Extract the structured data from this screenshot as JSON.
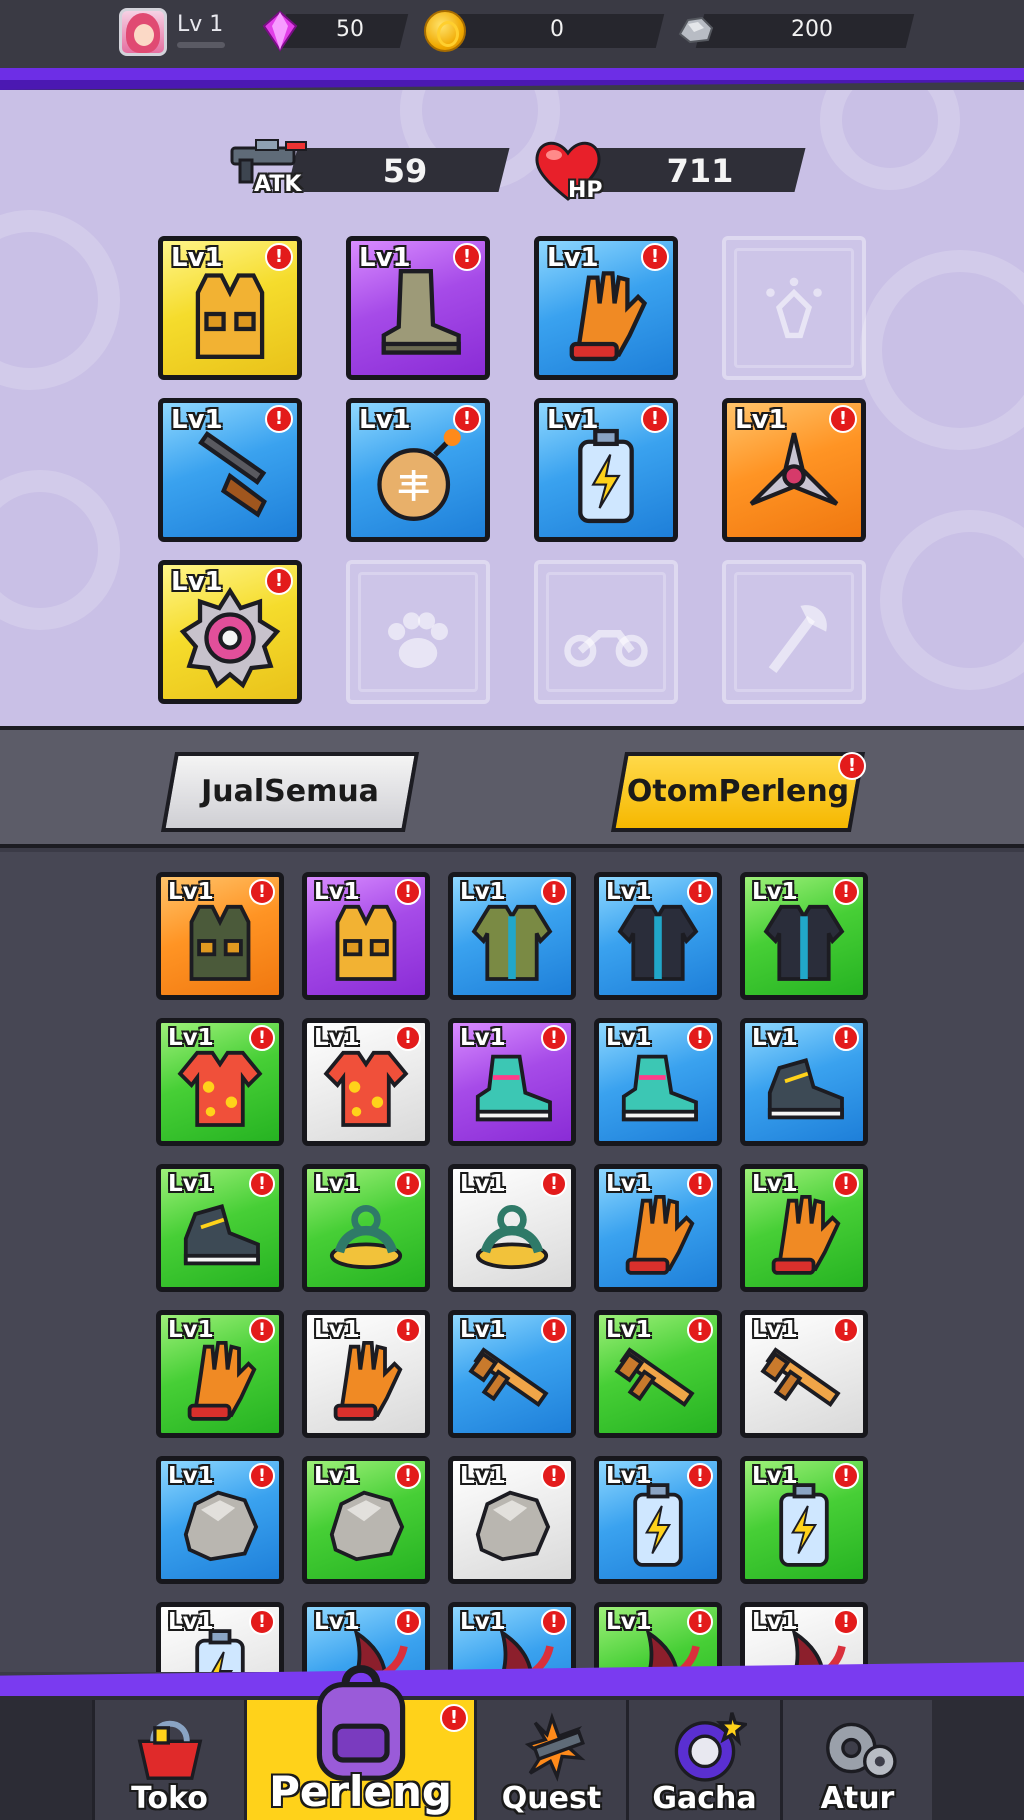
{
  "player": {
    "level_label": "Lv 1"
  },
  "resources": {
    "gems": "50",
    "coins": "0",
    "ore": "200"
  },
  "stats": {
    "atk_label": "ATK",
    "atk_value": "59",
    "hp_label": "HP",
    "hp_value": "711"
  },
  "equipped": [
    {
      "item": "vest-icon",
      "rarity": "yellow",
      "level": "Lv1",
      "alert": "!"
    },
    {
      "item": "boot-icon",
      "rarity": "purple",
      "level": "Lv1",
      "alert": "!"
    },
    {
      "item": "glove-icon",
      "rarity": "blue",
      "level": "Lv1",
      "alert": "!"
    },
    {
      "item": "gem-slot-icon",
      "rarity": "empty"
    },
    {
      "item": "rifle-icon",
      "rarity": "blue",
      "level": "Lv1",
      "alert": "!"
    },
    {
      "item": "bomb-icon",
      "rarity": "blue",
      "level": "Lv1",
      "alert": "!"
    },
    {
      "item": "battery-icon",
      "rarity": "blue",
      "level": "Lv1",
      "alert": "!"
    },
    {
      "item": "shuriken-icon",
      "rarity": "orange",
      "level": "Lv1",
      "alert": "!"
    },
    {
      "item": "sawblade-icon",
      "rarity": "yellow",
      "level": "Lv1",
      "alert": "!"
    },
    {
      "item": "paw-slot-icon",
      "rarity": "empty"
    },
    {
      "item": "motorcycle-slot-icon",
      "rarity": "empty"
    },
    {
      "item": "axe-slot-icon",
      "rarity": "empty"
    }
  ],
  "buttons": {
    "sell_all": "JualSemua",
    "auto_upgrade": "OtomPerleng",
    "auto_upgrade_alert": "!"
  },
  "inventory": [
    {
      "item": "tactical-vest-icon",
      "rarity": "orange",
      "level": "Lv1",
      "alert": "!"
    },
    {
      "item": "vest-icon",
      "rarity": "purple",
      "level": "Lv1",
      "alert": "!"
    },
    {
      "item": "jacket-icon",
      "rarity": "blue",
      "level": "Lv1",
      "alert": "!"
    },
    {
      "item": "dark-jacket-icon",
      "rarity": "blue",
      "level": "Lv1",
      "alert": "!"
    },
    {
      "item": "dark-jacket-icon",
      "rarity": "green",
      "level": "Lv1",
      "alert": "!"
    },
    {
      "item": "hawaiian-shirt-icon",
      "rarity": "green",
      "level": "Lv1",
      "alert": "!"
    },
    {
      "item": "hawaiian-shirt-icon",
      "rarity": "white",
      "level": "Lv1",
      "alert": "!"
    },
    {
      "item": "sneaker-icon",
      "rarity": "purple",
      "level": "Lv1",
      "alert": "!"
    },
    {
      "item": "sneaker-icon",
      "rarity": "blue",
      "level": "Lv1",
      "alert": "!"
    },
    {
      "item": "shoe-icon",
      "rarity": "blue",
      "level": "Lv1",
      "alert": "!"
    },
    {
      "item": "shoe-icon",
      "rarity": "green",
      "level": "Lv1",
      "alert": "!"
    },
    {
      "item": "sandal-icon",
      "rarity": "green",
      "level": "Lv1",
      "alert": "!"
    },
    {
      "item": "sandal-icon",
      "rarity": "white",
      "level": "Lv1",
      "alert": "!"
    },
    {
      "item": "glove-icon",
      "rarity": "blue",
      "level": "Lv1",
      "alert": "!"
    },
    {
      "item": "glove-icon",
      "rarity": "green",
      "level": "Lv1",
      "alert": "!"
    },
    {
      "item": "glove-icon",
      "rarity": "green",
      "level": "Lv1",
      "alert": "!"
    },
    {
      "item": "glove-icon",
      "rarity": "white",
      "level": "Lv1",
      "alert": "!"
    },
    {
      "item": "assault-rifle-icon",
      "rarity": "blue",
      "level": "Lv1",
      "alert": "!"
    },
    {
      "item": "assault-rifle-icon",
      "rarity": "green",
      "level": "Lv1",
      "alert": "!"
    },
    {
      "item": "assault-rifle-icon",
      "rarity": "white",
      "level": "Lv1",
      "alert": "!"
    },
    {
      "item": "rock-icon",
      "rarity": "blue",
      "level": "Lv1",
      "alert": "!"
    },
    {
      "item": "rock-icon",
      "rarity": "green",
      "level": "Lv1",
      "alert": "!"
    },
    {
      "item": "rock-icon",
      "rarity": "white",
      "level": "Lv1",
      "alert": "!"
    },
    {
      "item": "battery-icon",
      "rarity": "blue",
      "level": "Lv1",
      "alert": "!"
    },
    {
      "item": "battery-icon",
      "rarity": "green",
      "level": "Lv1",
      "alert": "!"
    },
    {
      "item": "battery-icon",
      "rarity": "white",
      "level": "Lv1",
      "alert": "!"
    },
    {
      "item": "blade-icon",
      "rarity": "blue",
      "level": "Lv1",
      "alert": "!"
    },
    {
      "item": "blade-icon",
      "rarity": "blue",
      "level": "Lv1",
      "alert": "!"
    },
    {
      "item": "blade-icon",
      "rarity": "green",
      "level": "Lv1",
      "alert": "!"
    },
    {
      "item": "blade-icon",
      "rarity": "white",
      "level": "Lv1",
      "alert": "!"
    }
  ],
  "nav": [
    {
      "label": "Toko",
      "icon": "basket-icon",
      "active": false
    },
    {
      "label": "Perleng",
      "icon": "backpack-icon",
      "active": true,
      "alert": "!"
    },
    {
      "label": "Quest",
      "icon": "gun-burst-icon",
      "active": false
    },
    {
      "label": "Gacha",
      "icon": "gacha-orb-icon",
      "active": false
    },
    {
      "label": "Atur",
      "icon": "gears-icon",
      "active": false
    }
  ],
  "colors": {
    "yellow": "#f5dc2c",
    "purple": "#a64be8",
    "blue": "#3aa2ef",
    "orange": "#ff9424",
    "green": "#47cf36",
    "white": "#eeeeee",
    "panel": "#c9c0e6",
    "accent": "#7a3bf0",
    "alert": "#e31b1b"
  }
}
